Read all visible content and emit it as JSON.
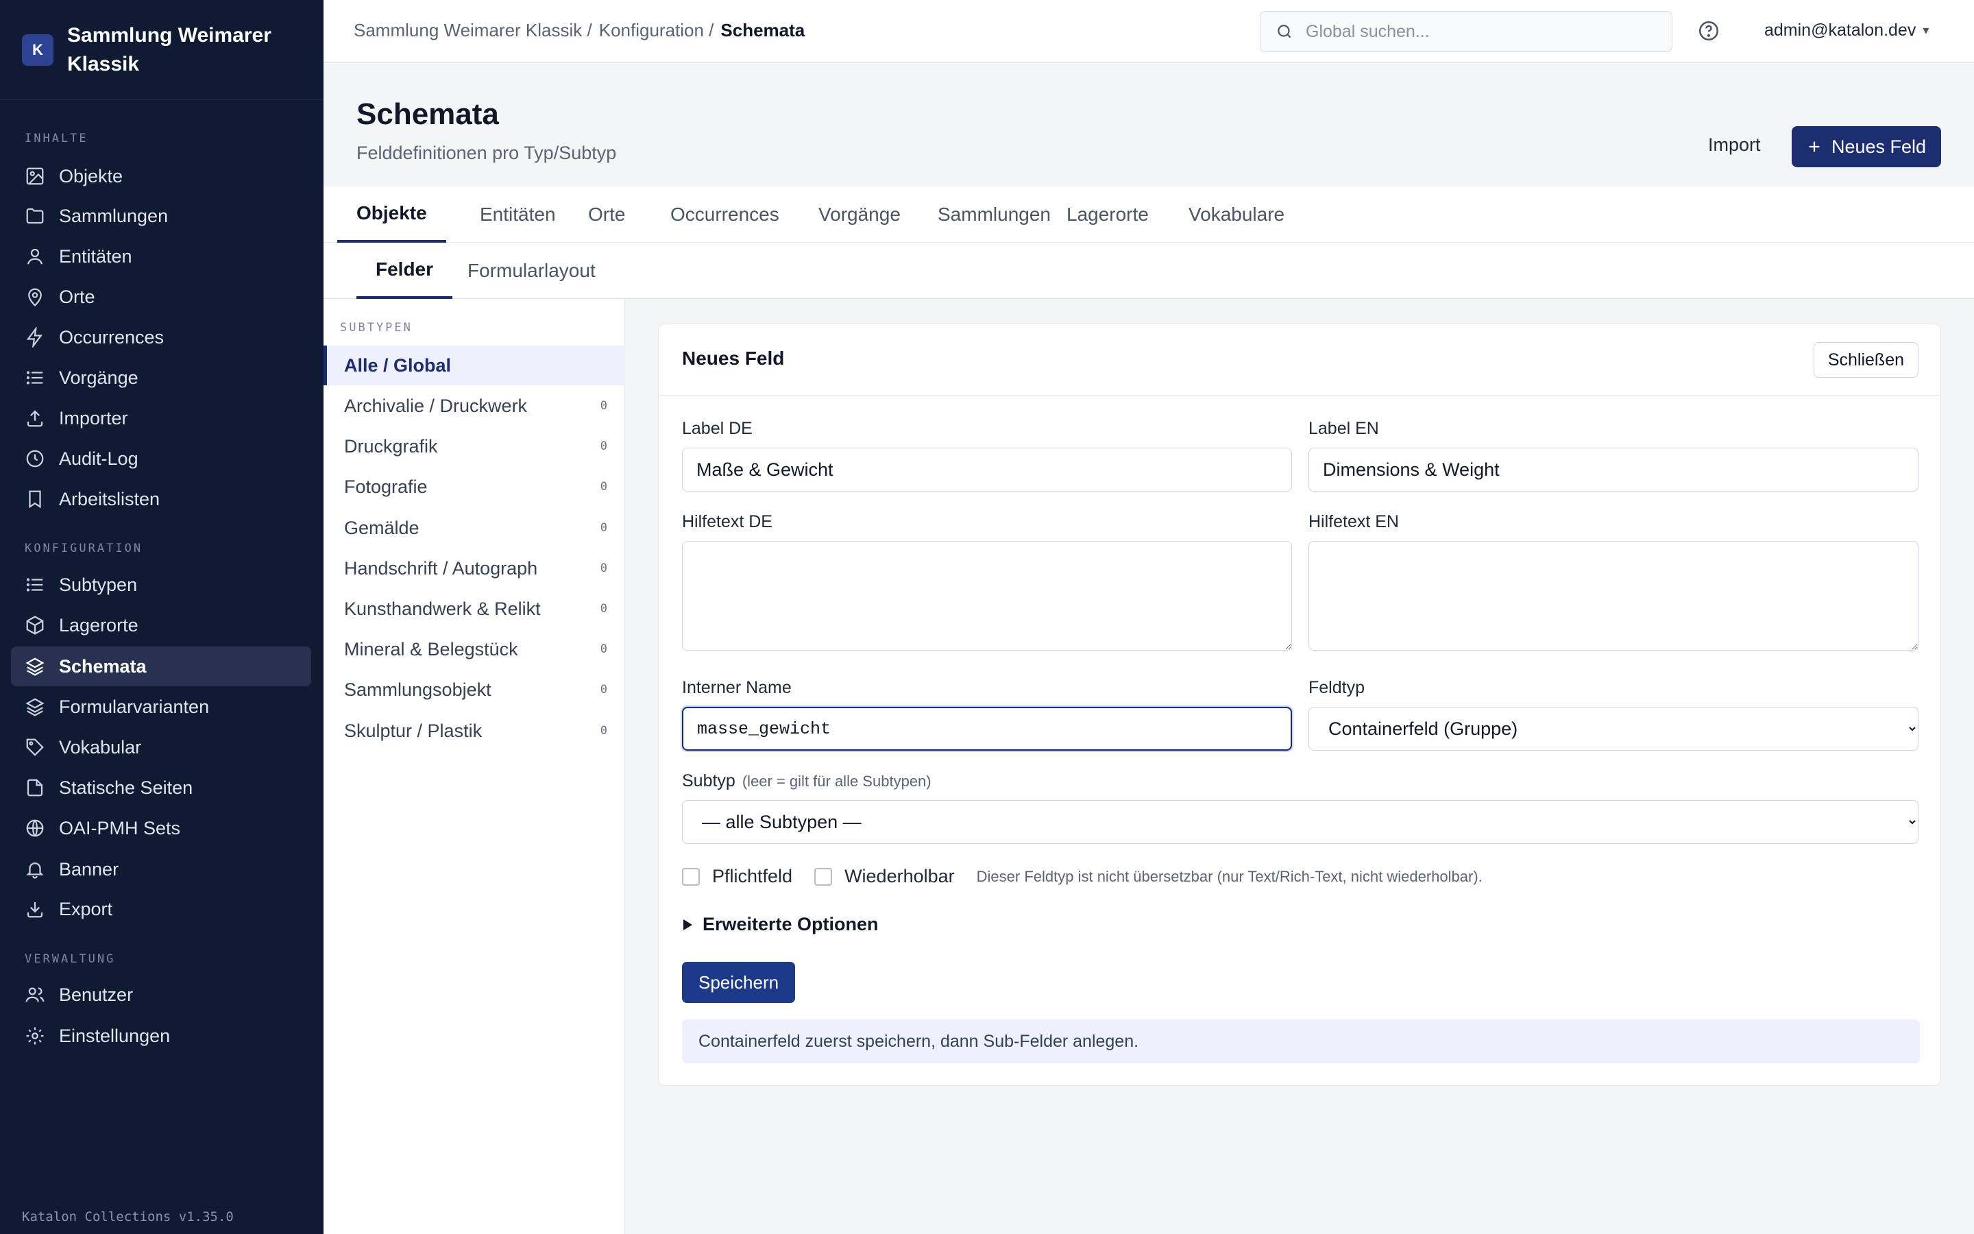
{
  "app": {
    "logo_letter": "K",
    "title": "Sammlung Weimarer Klassik",
    "version": "Katalon Collections v1.35.0"
  },
  "sidebar": {
    "sections": [
      {
        "label": "INHALTE",
        "items": [
          {
            "label": "Objekte",
            "icon": "image-icon"
          },
          {
            "label": "Sammlungen",
            "icon": "folder-icon"
          },
          {
            "label": "Entitäten",
            "icon": "user-icon"
          },
          {
            "label": "Orte",
            "icon": "map-pin-icon"
          },
          {
            "label": "Occurrences",
            "icon": "bolt-icon"
          },
          {
            "label": "Vorgänge",
            "icon": "list-icon"
          },
          {
            "label": "Importer",
            "icon": "upload-icon"
          },
          {
            "label": "Audit-Log",
            "icon": "clock-icon"
          },
          {
            "label": "Arbeitslisten",
            "icon": "bookmark-icon"
          }
        ]
      },
      {
        "label": "KONFIGURATION",
        "items": [
          {
            "label": "Subtypen",
            "icon": "list-icon"
          },
          {
            "label": "Lagerorte",
            "icon": "box-icon"
          },
          {
            "label": "Schemata",
            "icon": "layers-icon",
            "active": true
          },
          {
            "label": "Formularvarianten",
            "icon": "layers-icon"
          },
          {
            "label": "Vokabular",
            "icon": "tag-icon"
          },
          {
            "label": "Statische Seiten",
            "icon": "file-icon"
          },
          {
            "label": "OAI-PMH Sets",
            "icon": "globe-icon"
          },
          {
            "label": "Banner",
            "icon": "bell-icon"
          },
          {
            "label": "Export",
            "icon": "download-icon"
          }
        ]
      },
      {
        "label": "VERWALTUNG",
        "items": [
          {
            "label": "Benutzer",
            "icon": "users-icon"
          },
          {
            "label": "Einstellungen",
            "icon": "gear-icon"
          }
        ]
      }
    ]
  },
  "topbar": {
    "breadcrumb": [
      "Sammlung Weimarer Klassik /",
      "Konfiguration /",
      "Schemata"
    ],
    "search_placeholder": "Global suchen...",
    "user": "admin@katalon.dev",
    "user_caret": "▾"
  },
  "page": {
    "title": "Schemata",
    "subtitle": "Felddefinitionen pro Typ/Subtyp",
    "import_label": "Import",
    "new_field_label": "Neues Feld"
  },
  "tabs": [
    "Objekte",
    "Entitäten",
    "Orte",
    "Occurrences",
    "Vorgänge",
    "Sammlungen",
    "Lagerorte",
    "Vokabulare"
  ],
  "subtabs": [
    "Felder",
    "Formularlayout"
  ],
  "subtypes": {
    "label": "SUBTYPEN",
    "items": [
      {
        "name": "Alle / Global",
        "count": "",
        "active": true
      },
      {
        "name": "Archivalie / Druckwerk",
        "count": "0"
      },
      {
        "name": "Druckgrafik",
        "count": "0"
      },
      {
        "name": "Fotografie",
        "count": "0"
      },
      {
        "name": "Gemälde",
        "count": "0"
      },
      {
        "name": "Handschrift / Autograph",
        "count": "0"
      },
      {
        "name": "Kunsthandwerk & Relikt",
        "count": "0"
      },
      {
        "name": "Mineral & Belegstück",
        "count": "0"
      },
      {
        "name": "Sammlungsobjekt",
        "count": "0"
      },
      {
        "name": "Skulptur / Plastik",
        "count": "0"
      }
    ]
  },
  "form": {
    "title": "Neues Feld",
    "close_label": "Schließen",
    "label_de": {
      "label": "Label DE",
      "value": "Maße & Gewicht"
    },
    "label_en": {
      "label": "Label EN",
      "value": "Dimensions & Weight"
    },
    "help_de": {
      "label": "Hilfetext DE",
      "value": ""
    },
    "help_en": {
      "label": "Hilfetext EN",
      "value": ""
    },
    "internal_name": {
      "label": "Interner Name",
      "value": "masse_gewicht"
    },
    "field_type": {
      "label": "Feldtyp",
      "value": "Containerfeld (Gruppe)"
    },
    "subtype": {
      "label": "Subtyp",
      "hint": "(leer = gilt für alle Subtypen)",
      "value": "— alle Subtypen —"
    },
    "required_label": "Pflichtfeld",
    "repeatable_label": "Wiederholbar",
    "translatable_note": "Dieser Feldtyp ist nicht übersetzbar (nur Text/Rich-Text, nicht wiederholbar).",
    "advanced_label": "Erweiterte Optionen",
    "save_label": "Speichern",
    "info": "Containerfeld zuerst speichern, dann Sub-Felder anlegen."
  }
}
